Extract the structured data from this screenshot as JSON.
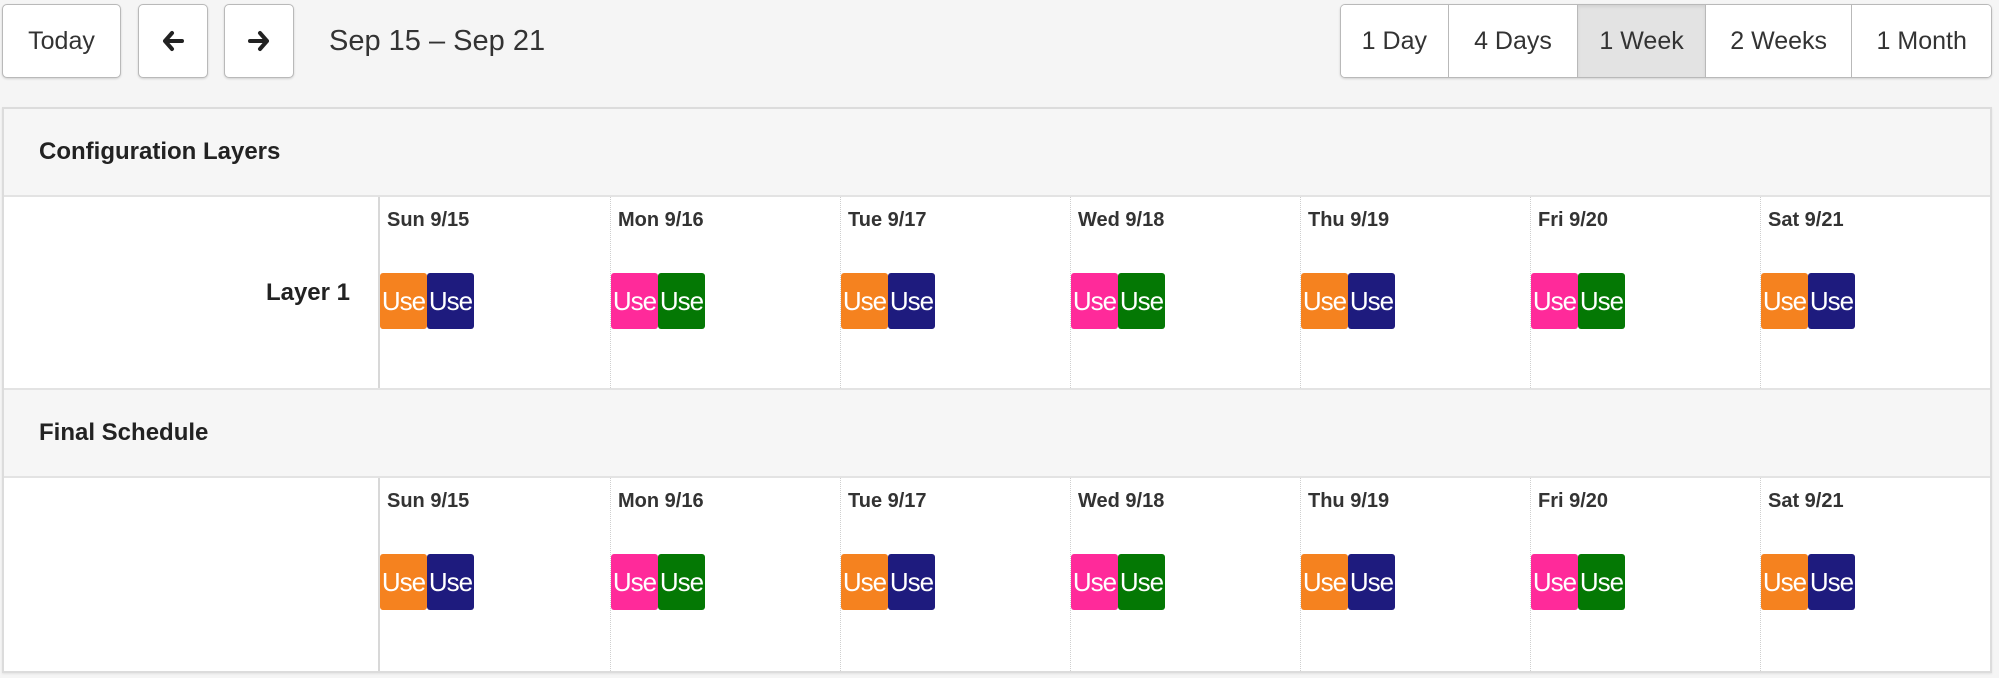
{
  "toolbar": {
    "today_label": "Today",
    "prev_icon": "arrow-left-icon",
    "next_icon": "arrow-right-icon",
    "date_range": "Sep 15 – Sep 21"
  },
  "views": [
    {
      "label": "1 Day",
      "active": false
    },
    {
      "label": "4 Days",
      "active": false
    },
    {
      "label": "1 Week",
      "active": true
    },
    {
      "label": "2 Weeks",
      "active": false
    },
    {
      "label": "1 Month",
      "active": false
    }
  ],
  "colors": {
    "orange": "#f5821f",
    "navy": "#1e1b7e",
    "pink": "#ff2a9a",
    "green": "#047804"
  },
  "sections": [
    {
      "title": "Configuration Layers",
      "row_label": "Layer 1",
      "days": [
        {
          "label": "Sun 9/15",
          "events": [
            {
              "text": "Use",
              "color": "#f5821f"
            },
            {
              "text": "Use",
              "color": "#1e1b7e"
            }
          ]
        },
        {
          "label": "Mon 9/16",
          "events": [
            {
              "text": "Use",
              "color": "#ff2a9a"
            },
            {
              "text": "Use",
              "color": "#047804"
            }
          ]
        },
        {
          "label": "Tue 9/17",
          "events": [
            {
              "text": "Use",
              "color": "#f5821f"
            },
            {
              "text": "Use",
              "color": "#1e1b7e"
            }
          ]
        },
        {
          "label": "Wed 9/18",
          "events": [
            {
              "text": "Use",
              "color": "#ff2a9a"
            },
            {
              "text": "Use",
              "color": "#047804"
            }
          ]
        },
        {
          "label": "Thu 9/19",
          "events": [
            {
              "text": "Use",
              "color": "#f5821f"
            },
            {
              "text": "Use",
              "color": "#1e1b7e"
            }
          ]
        },
        {
          "label": "Fri 9/20",
          "events": [
            {
              "text": "Use",
              "color": "#ff2a9a"
            },
            {
              "text": "Use",
              "color": "#047804"
            }
          ]
        },
        {
          "label": "Sat 9/21",
          "events": [
            {
              "text": "Use",
              "color": "#f5821f"
            },
            {
              "text": "Use",
              "color": "#1e1b7e"
            }
          ]
        }
      ]
    },
    {
      "title": "Final Schedule",
      "row_label": "",
      "days": [
        {
          "label": "Sun 9/15",
          "events": [
            {
              "text": "Use",
              "color": "#f5821f"
            },
            {
              "text": "Use",
              "color": "#1e1b7e"
            }
          ]
        },
        {
          "label": "Mon 9/16",
          "events": [
            {
              "text": "Use",
              "color": "#ff2a9a"
            },
            {
              "text": "Use",
              "color": "#047804"
            }
          ]
        },
        {
          "label": "Tue 9/17",
          "events": [
            {
              "text": "Use",
              "color": "#f5821f"
            },
            {
              "text": "Use",
              "color": "#1e1b7e"
            }
          ]
        },
        {
          "label": "Wed 9/18",
          "events": [
            {
              "text": "Use",
              "color": "#ff2a9a"
            },
            {
              "text": "Use",
              "color": "#047804"
            }
          ]
        },
        {
          "label": "Thu 9/19",
          "events": [
            {
              "text": "Use",
              "color": "#f5821f"
            },
            {
              "text": "Use",
              "color": "#1e1b7e"
            }
          ]
        },
        {
          "label": "Fri 9/20",
          "events": [
            {
              "text": "Use",
              "color": "#ff2a9a"
            },
            {
              "text": "Use",
              "color": "#047804"
            }
          ]
        },
        {
          "label": "Sat 9/21",
          "events": [
            {
              "text": "Use",
              "color": "#f5821f"
            },
            {
              "text": "Use",
              "color": "#1e1b7e"
            }
          ]
        }
      ]
    }
  ]
}
